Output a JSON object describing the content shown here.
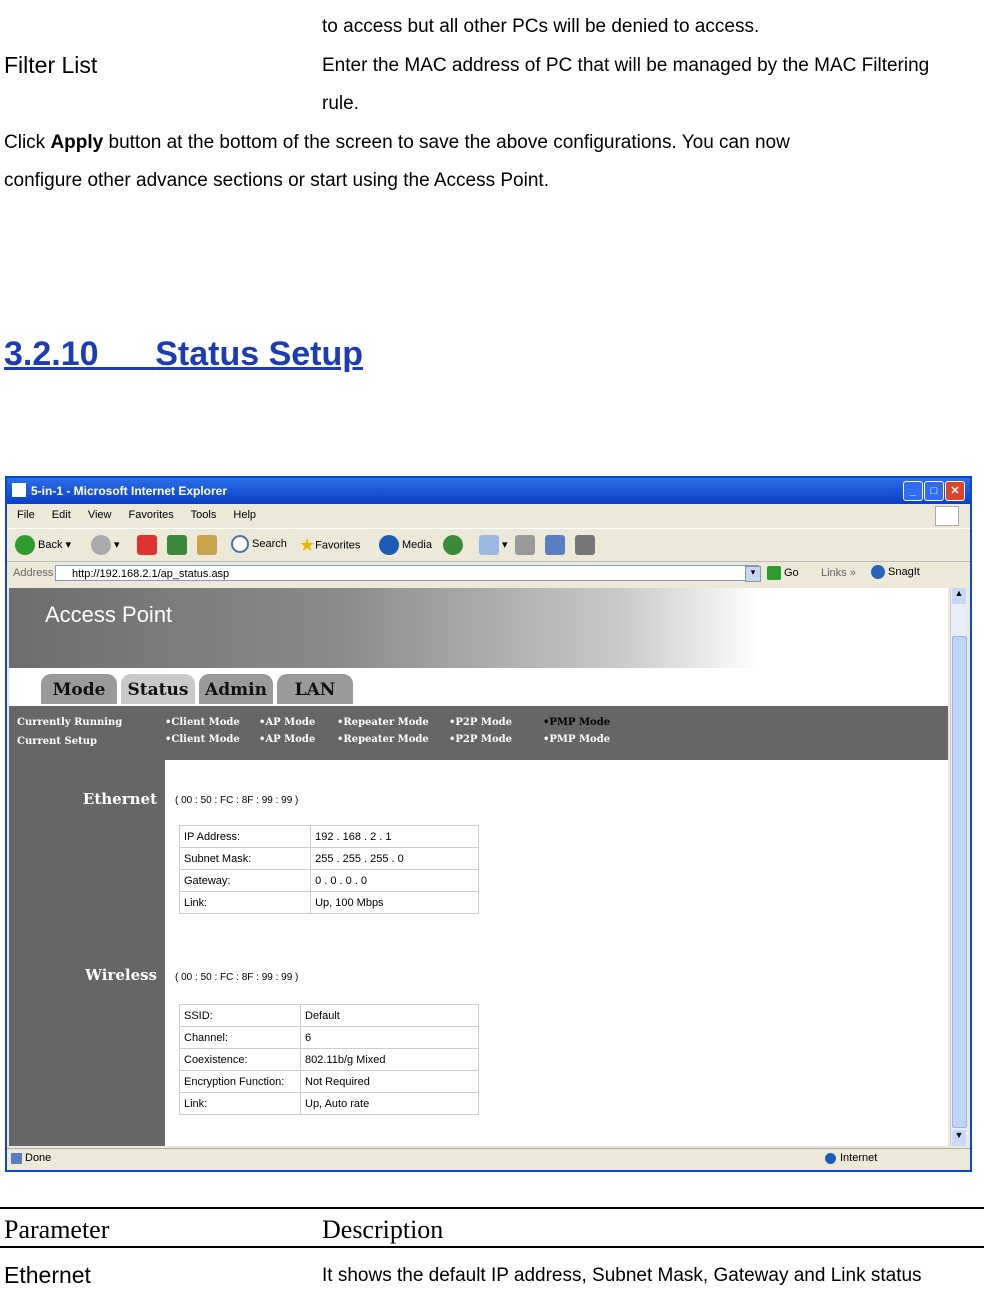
{
  "doc": {
    "intro_line1": "to access but all other PCs will be denied to access.",
    "filter_list_label": "Filter List",
    "filter_list_desc1": "Enter the MAC address of PC that will be managed by the MAC Filtering",
    "filter_list_desc2": "rule.",
    "click_prefix": "Click ",
    "apply_word": "Apply",
    "click_rest": " button at the bottom of the screen to save the above configurations. You can now",
    "click_line2": "configure other advance sections or start using the Access Point.",
    "heading_num": "3.2.10",
    "heading_text": "Status Setup",
    "param_header": "Parameter",
    "desc_header": "Description",
    "ethernet_param": "Ethernet",
    "ethernet_desc": "It shows the default IP address, Subnet Mask, Gateway and Link status"
  },
  "browser": {
    "title": "5-in-1 - Microsoft Internet Explorer",
    "menu": [
      "File",
      "Edit",
      "View",
      "Favorites",
      "Tools",
      "Help"
    ],
    "back": "Back",
    "search": "Search",
    "favorites": "Favorites",
    "media": "Media",
    "address_label": "Address",
    "url": "http://192.168.2.1/ap_status.asp",
    "go": "Go",
    "links": "Links",
    "snagit": "SnagIt",
    "status_done": "Done",
    "status_zone": "Internet"
  },
  "app": {
    "banner_title": "Access Point",
    "tabs": [
      "Mode",
      "Status",
      "Admin",
      "LAN"
    ],
    "active_tab": "Status",
    "running_label": "Currently Running",
    "setup_label": "Current Setup",
    "modes": [
      "•Client Mode",
      "•AP Mode",
      "•Repeater Mode",
      "•P2P Mode",
      "•PMP Mode"
    ],
    "ethernet": {
      "label": "Ethernet",
      "mac": "( 00 : 50 : FC : 8F : 99 : 99 )",
      "rows": [
        [
          "IP Address:",
          "192 . 168 . 2 . 1"
        ],
        [
          "Subnet Mask:",
          "255 . 255 . 255 . 0"
        ],
        [
          "Gateway:",
          "0 . 0 . 0 . 0"
        ],
        [
          "Link:",
          "Up, 100 Mbps"
        ]
      ]
    },
    "wireless": {
      "label": "Wireless",
      "mac": "( 00 : 50 : FC : 8F : 99 : 99 )",
      "rows": [
        [
          "SSID:",
          "Default"
        ],
        [
          "Channel:",
          "6"
        ],
        [
          "Coexistence:",
          "802.11b/g Mixed"
        ],
        [
          "Encryption Function:",
          "Not Required"
        ],
        [
          "Link:",
          "Up,  Auto rate"
        ]
      ]
    }
  }
}
